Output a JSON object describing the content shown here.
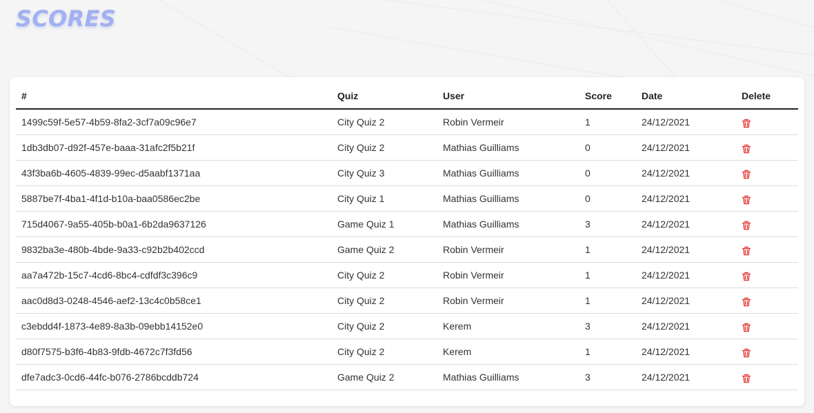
{
  "header": {
    "title": "SCORES"
  },
  "table": {
    "columns": [
      "#",
      "Quiz",
      "User",
      "Score",
      "Date",
      "Delete"
    ],
    "rows": [
      {
        "id": "1499c59f-5e57-4b59-8fa2-3cf7a09c96e7",
        "quiz": "City Quiz 2",
        "user": "Robin Vermeir",
        "score": "1",
        "date": "24/12/2021"
      },
      {
        "id": "1db3db07-d92f-457e-baaa-31afc2f5b21f",
        "quiz": "City Quiz 2",
        "user": "Mathias Guilliams",
        "score": "0",
        "date": "24/12/2021"
      },
      {
        "id": "43f3ba6b-4605-4839-99ec-d5aabf1371aa",
        "quiz": "City Quiz 3",
        "user": "Mathias Guilliams",
        "score": "0",
        "date": "24/12/2021"
      },
      {
        "id": "5887be7f-4ba1-4f1d-b10a-baa0586ec2be",
        "quiz": "City Quiz 1",
        "user": "Mathias Guilliams",
        "score": "0",
        "date": "24/12/2021"
      },
      {
        "id": "715d4067-9a55-405b-b0a1-6b2da9637126",
        "quiz": "Game Quiz 1",
        "user": "Mathias Guilliams",
        "score": "3",
        "date": "24/12/2021"
      },
      {
        "id": "9832ba3e-480b-4bde-9a33-c92b2b402ccd",
        "quiz": "Game Quiz 2",
        "user": "Robin Vermeir",
        "score": "1",
        "date": "24/12/2021"
      },
      {
        "id": "aa7a472b-15c7-4cd6-8bc4-cdfdf3c396c9",
        "quiz": "City Quiz 2",
        "user": "Robin Vermeir",
        "score": "1",
        "date": "24/12/2021"
      },
      {
        "id": "aac0d8d3-0248-4546-aef2-13c4c0b58ce1",
        "quiz": "City Quiz 2",
        "user": "Robin Vermeir",
        "score": "1",
        "date": "24/12/2021"
      },
      {
        "id": "c3ebdd4f-1873-4e89-8a3b-09ebb14152e0",
        "quiz": "City Quiz 2",
        "user": "Kerem",
        "score": "3",
        "date": "24/12/2021"
      },
      {
        "id": "d80f7575-b3f6-4b83-9fdb-4672c7f3fd56",
        "quiz": "City Quiz 2",
        "user": "Kerem",
        "score": "1",
        "date": "24/12/2021"
      },
      {
        "id": "dfe7adc3-0cd6-44fc-b076-2786bcddb724",
        "quiz": "Game Quiz 2",
        "user": "Mathias Guilliams",
        "score": "3",
        "date": "24/12/2021"
      }
    ],
    "delete_icon": "trash-icon"
  },
  "colors": {
    "title": "#a3b0f0",
    "delete_icon": "#e53935",
    "background": "#f5f5f5",
    "card": "#ffffff"
  }
}
